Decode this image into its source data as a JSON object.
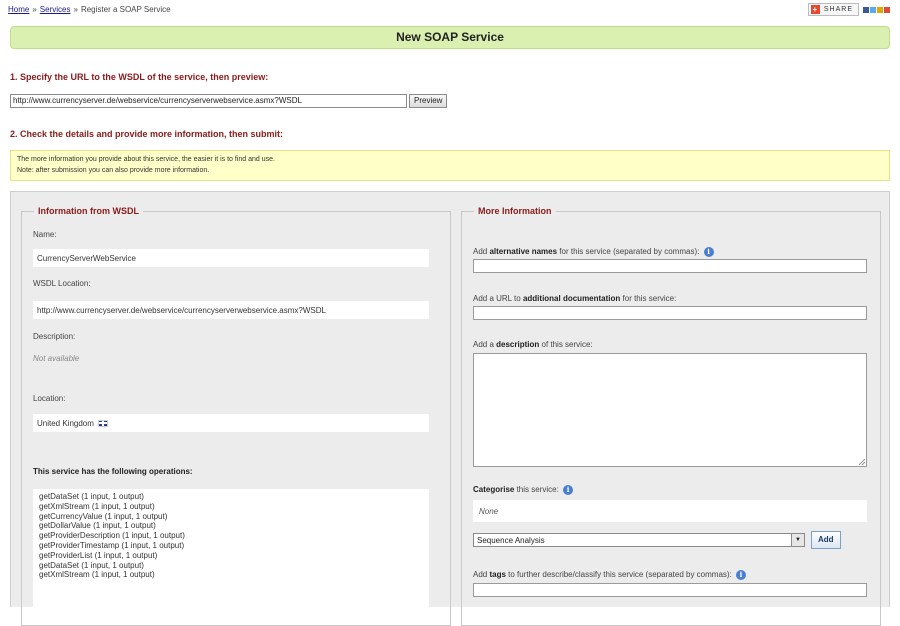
{
  "breadcrumb": {
    "home": "Home",
    "sep1": "»",
    "services": "Services",
    "sep2": "»",
    "current": "Register a SOAP Service"
  },
  "share": {
    "label": "SHARE",
    "plus": "+"
  },
  "banner": {
    "title": "New SOAP Service"
  },
  "step1": {
    "heading": "1. Specify the URL to the WSDL of the service, then preview:",
    "url_value": "http://www.currencyserver.de/webservice/currencyserverwebservice.asmx?WSDL",
    "preview_label": "Preview"
  },
  "step2": {
    "heading": "2. Check the details and provide more information, then submit:"
  },
  "notice": {
    "line1": "The more information you provide about this service, the easier it is to find and use.",
    "line2": "Note: after submission you can also provide more information."
  },
  "wsdl_info": {
    "legend": "Information from WSDL",
    "name_label": "Name:",
    "name_value": "CurrencyServerWebService",
    "location_label": "WSDL Location:",
    "location_value": "http://www.currencyserver.de/webservice/currencyserverwebservice.asmx?WSDL",
    "description_label": "Description:",
    "description_value": "Not available",
    "geo_label": "Location:",
    "geo_value": "United Kingdom",
    "ops_title": "This service has the following operations:",
    "operations": [
      "getDataSet (1 input, 1 output)",
      "getXmlStream (1 input, 1 output)",
      "getCurrencyValue (1 input, 1 output)",
      "getDollarValue (1 input, 1 output)",
      "getProviderDescription (1 input, 1 output)",
      "getProviderTimestamp (1 input, 1 output)",
      "getProviderList (1 input, 1 output)",
      "getDataSet (1 input, 1 output)",
      "getXmlStream (1 input, 1 output)"
    ]
  },
  "more_info": {
    "legend": "More Information",
    "alt_names": {
      "pre": "Add ",
      "bold": "alternative names",
      "post": " for this service (separated by commas):"
    },
    "doc_url": {
      "pre": "Add a URL to ",
      "bold": "additional documentation",
      "post": " for this service:"
    },
    "description": {
      "pre": "Add a ",
      "bold": "description",
      "post": " of this service:"
    },
    "categorise": {
      "bold": "Categorise",
      "post": " this service:"
    },
    "category_none": "None",
    "category_select": "Sequence Analysis",
    "add_label": "Add",
    "tags": {
      "pre": "Add ",
      "bold": "tags",
      "post": " to further describe/classify this service (separated by commas):"
    }
  },
  "icons": {
    "info": "i"
  }
}
